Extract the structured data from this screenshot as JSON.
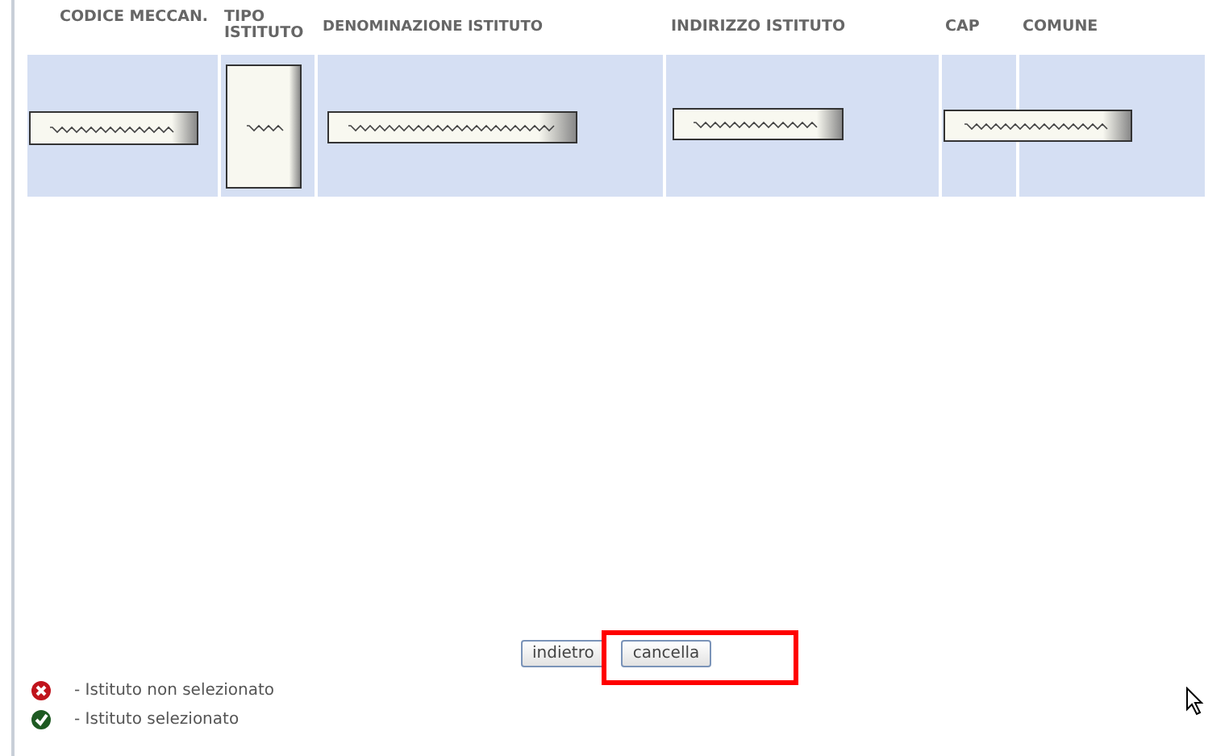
{
  "table": {
    "columns": [
      {
        "label": "CODICE MECCAN."
      },
      {
        "label": "TIPO ISTITUTO"
      },
      {
        "label": "DENOMINAZIONE ISTITUTO"
      },
      {
        "label": "INDIRIZZO ISTITUTO"
      },
      {
        "label": "CAP"
      },
      {
        "label": "COMUNE"
      }
    ]
  },
  "buttons": [
    {
      "label": "indietro"
    },
    {
      "label": "cancella"
    }
  ],
  "legend": [
    {
      "kind": "not_selected",
      "label": "- Istituto non selezionato"
    },
    {
      "kind": "selected",
      "label": "- Istituto selezionato"
    }
  ]
}
